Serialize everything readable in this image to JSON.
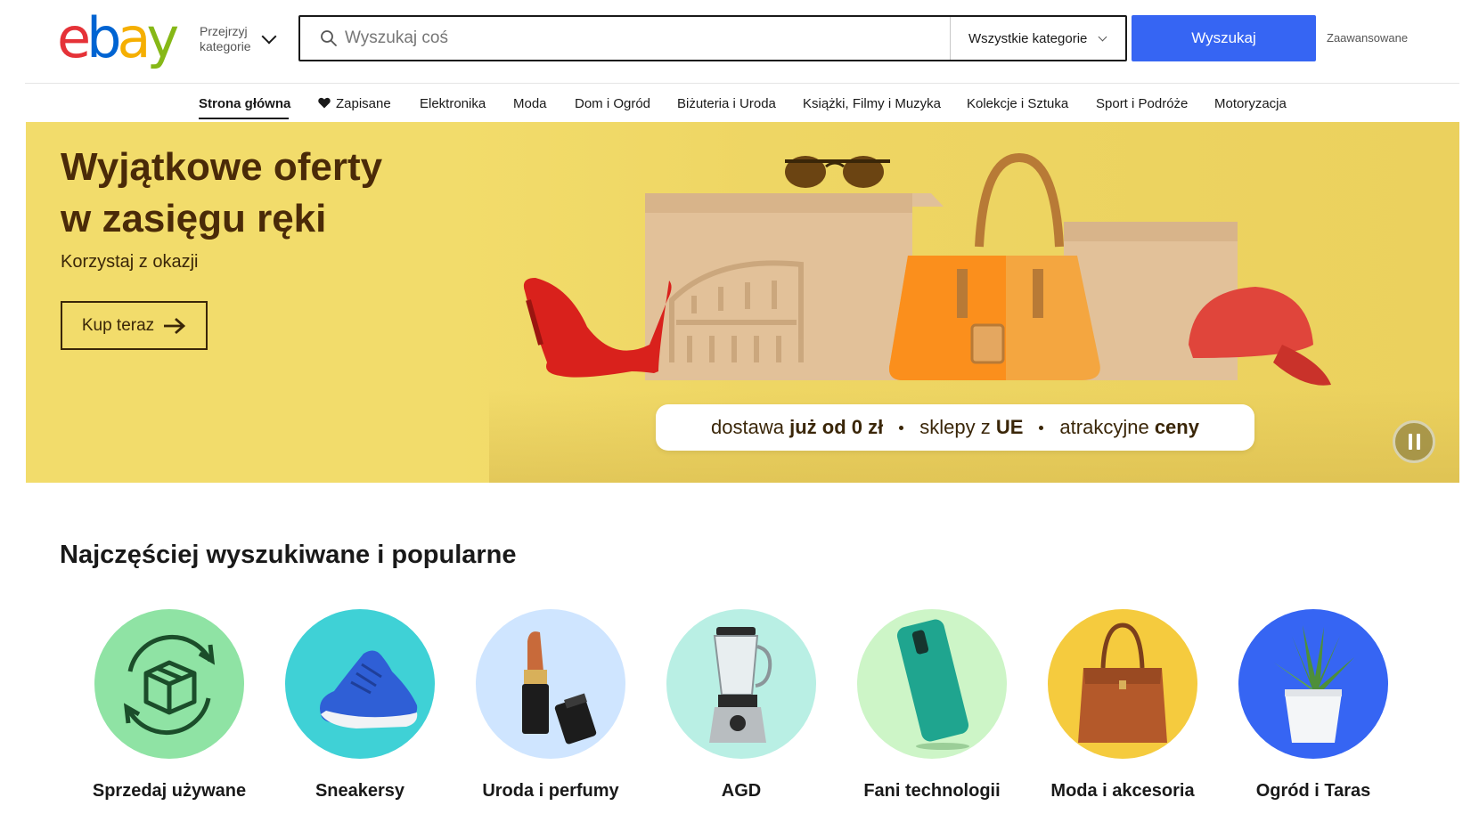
{
  "header": {
    "logo": {
      "letters": [
        "e",
        "b",
        "a",
        "y"
      ],
      "colors": [
        "#e53238",
        "#0064d2",
        "#f5af02",
        "#86b817"
      ]
    },
    "shop_by_category": "Przejrzyj kategorie",
    "search": {
      "placeholder": "Wyszukaj coś",
      "category": "Wszystkie kategorie",
      "button": "Wyszukaj"
    },
    "advanced": "Zaawansowane"
  },
  "nav": {
    "items": [
      {
        "label": "Strona główna",
        "active": true
      },
      {
        "label": "Zapisane",
        "icon": "heart-icon"
      },
      {
        "label": "Elektronika"
      },
      {
        "label": "Moda"
      },
      {
        "label": "Dom i Ogród"
      },
      {
        "label": "Biżuteria i Uroda"
      },
      {
        "label": "Książki, Filmy i Muzyka"
      },
      {
        "label": "Kolekcje i Sztuka"
      },
      {
        "label": "Sport i Podróże"
      },
      {
        "label": "Motoryzacja"
      }
    ]
  },
  "hero": {
    "title_line1": "Wyjątkowe oferty",
    "title_line2": "w zasięgu ręki",
    "subtitle": "Korzystaj z okazji",
    "cta": "Kup teraz",
    "banner": {
      "part1_light": "dostawa",
      "part1_bold": "już od 0 zł",
      "part2_light": "sklepy z",
      "part2_bold": "UE",
      "part3_light": "atrakcyjne",
      "part3_bold": "ceny"
    },
    "background_color": "#f2dc6b"
  },
  "popular": {
    "title": "Najczęściej wyszukiwane i popularne",
    "categories": [
      {
        "label": "Sprzedaj używane",
        "color": "#8fe3a4",
        "icon": "recycle-box-icon"
      },
      {
        "label": "Sneakersy",
        "color": "#3fd1d6",
        "icon": "sneaker-icon"
      },
      {
        "label": "Uroda i perfumy",
        "color": "#cfe5ff",
        "icon": "lipstick-icon"
      },
      {
        "label": "AGD",
        "color": "#b9efe4",
        "icon": "blender-icon"
      },
      {
        "label": "Fani technologii",
        "color": "#cdf5c7",
        "icon": "phone-icon"
      },
      {
        "label": "Moda i akcesoria",
        "color": "#f5cb3e",
        "icon": "handbag-icon"
      },
      {
        "label": "Ogród i Taras",
        "color": "#3665f3",
        "icon": "plant-icon"
      }
    ]
  }
}
